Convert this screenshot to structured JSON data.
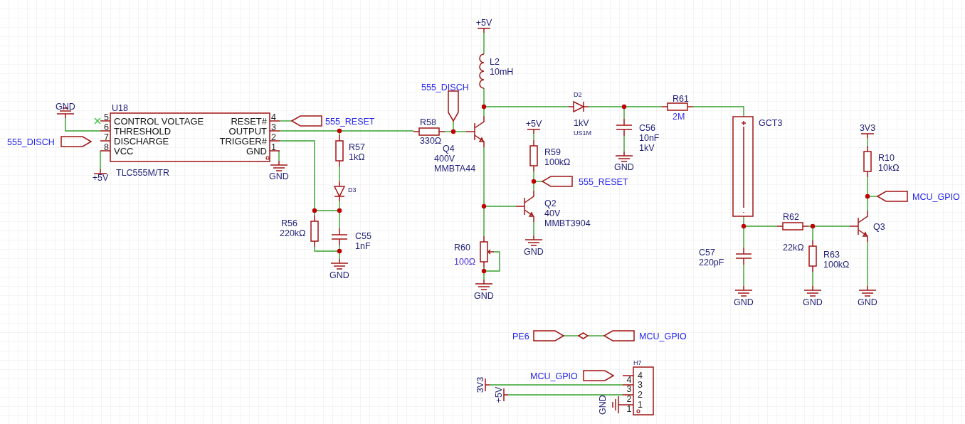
{
  "ic": {
    "designator": "U18",
    "part_number": "TLC555M/TR",
    "left_pins": [
      {
        "number": "5",
        "name": "CONTROL VOLTAGE",
        "no_connect": true
      },
      {
        "number": "6",
        "name": "THRESHOLD",
        "no_connect": false
      },
      {
        "number": "7",
        "name": "DISCHARGE",
        "no_connect": false
      },
      {
        "number": "8",
        "name": "VCC",
        "no_connect": false
      }
    ],
    "right_pins": [
      {
        "number": "4",
        "name": "RESET#"
      },
      {
        "number": "3",
        "name": "OUTPUT"
      },
      {
        "number": "2",
        "name": "TRIGGER#"
      },
      {
        "number": "1",
        "name": "GND"
      }
    ]
  },
  "power_ports": [
    {
      "kind": "ground",
      "label": "GND"
    },
    {
      "kind": "supply",
      "label": "+5V"
    },
    {
      "kind": "ground",
      "label": "GND"
    },
    {
      "kind": "ground",
      "label": "GND"
    },
    {
      "kind": "supply",
      "label": "+5V"
    },
    {
      "kind": "supply",
      "label": "+5V"
    },
    {
      "kind": "ground",
      "label": "GND"
    },
    {
      "kind": "ground",
      "label": "GND"
    },
    {
      "kind": "ground",
      "label": "GND"
    },
    {
      "kind": "supply",
      "label": "3V3"
    },
    {
      "kind": "ground",
      "label": "GND"
    },
    {
      "kind": "ground",
      "label": "GND"
    },
    {
      "kind": "ground",
      "label": "GND"
    },
    {
      "kind": "supply",
      "label": "3V3"
    },
    {
      "kind": "supply",
      "label": "+5V"
    },
    {
      "kind": "ground",
      "label": "GND"
    }
  ],
  "net_flags": [
    {
      "label": "555_RESET"
    },
    {
      "label": "555_DISCH"
    },
    {
      "label": "555_DISCH"
    },
    {
      "label": "555_RESET"
    },
    {
      "label": "MCU_GPIO"
    },
    {
      "label": "PE6"
    },
    {
      "label": "MCU_GPIO"
    },
    {
      "label": "MCU_GPIO"
    }
  ],
  "components": [
    {
      "kind": "resistor",
      "designator": "R57",
      "values": [
        "1kΩ"
      ]
    },
    {
      "kind": "diode",
      "designator": "D3"
    },
    {
      "kind": "resistor",
      "designator": "R56",
      "values": [
        "220kΩ"
      ]
    },
    {
      "kind": "capacitor",
      "designator": "C55",
      "values": [
        "1nF"
      ]
    },
    {
      "kind": "resistor",
      "designator": "R58",
      "values": [
        "330Ω"
      ]
    },
    {
      "kind": "inductor",
      "designator": "L2",
      "values": [
        "10mH"
      ]
    },
    {
      "kind": "npn",
      "designator": "Q4",
      "values": [
        "400V",
        "MMBTA44"
      ]
    },
    {
      "kind": "diode",
      "designator": "D2",
      "values": [
        "1kV",
        "US1M"
      ]
    },
    {
      "kind": "capacitor",
      "designator": "C56",
      "values": [
        "10nF",
        "1kV"
      ]
    },
    {
      "kind": "resistor",
      "designator": "R59",
      "values": [
        "100kΩ"
      ]
    },
    {
      "kind": "npn",
      "designator": "Q2",
      "values": [
        "40V",
        "MMBT3904"
      ]
    },
    {
      "kind": "potentiometer",
      "designator": "R60",
      "values": [
        "100Ω"
      ],
      "color": "#4b2fd6"
    },
    {
      "kind": "resistor",
      "designator": "R61",
      "values": [
        "2M"
      ],
      "color": "#3a2ee8"
    },
    {
      "kind": "gas_tube",
      "designator": "GCT3"
    },
    {
      "kind": "capacitor",
      "designator": "C57",
      "values": [
        "220pF"
      ]
    },
    {
      "kind": "resistor",
      "designator": "R62",
      "values": [
        "22kΩ"
      ]
    },
    {
      "kind": "resistor",
      "designator": "R63",
      "values": [
        "100kΩ"
      ]
    },
    {
      "kind": "resistor",
      "designator": "R10",
      "values": [
        "10kΩ"
      ]
    },
    {
      "kind": "npn",
      "designator": "Q3"
    }
  ],
  "connector": {
    "designator": "H7",
    "pins": [
      {
        "number": "4",
        "outer_number": "4"
      },
      {
        "number": "3",
        "outer_number": "3"
      },
      {
        "number": "2",
        "outer_number": "2"
      },
      {
        "number": "1",
        "outer_number": "1"
      }
    ]
  }
}
